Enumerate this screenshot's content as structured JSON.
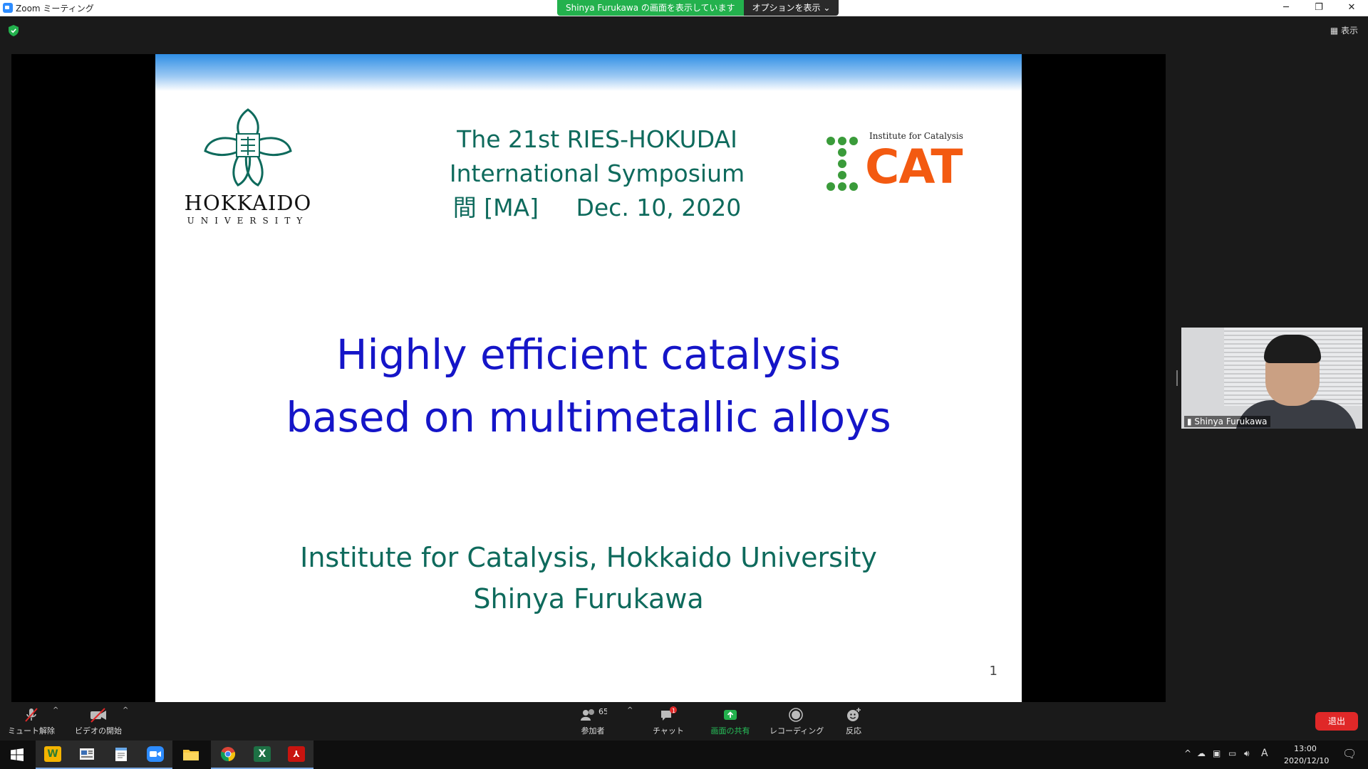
{
  "window": {
    "title": "Zoom ミーティング",
    "minimize": "─",
    "restore": "❐",
    "close": "✕"
  },
  "share_banner": {
    "message": "Shinya  Furukawa の画面を表示しています",
    "options": "オプションを表示 ⌄"
  },
  "view_button": "▦ 表示",
  "slide": {
    "hu_logo_name": "HOKKAIDO",
    "hu_logo_sub": "UNIVERSITY",
    "symposium_line1": "The 21st RIES-HOKUDAI",
    "symposium_line2": "International Symposium",
    "symposium_line3a": "間 [MA]",
    "symposium_line3b": "Dec. 10, 2020",
    "icat_label": "Institute for Catalysis",
    "icat_text": "CAT",
    "title_line1": "Highly efficient catalysis",
    "title_line2": "based on multimetallic alloys",
    "affiliation": "Institute for Catalysis, Hokkaido University",
    "author": "Shinya Furukawa",
    "page_number": "1",
    "colors": {
      "title": "#1515c8",
      "accent": "#0e6a5c",
      "icat": "#f35a11"
    }
  },
  "video_tile": {
    "name": "Shinya Furukawa"
  },
  "toolbar": {
    "mute": "ミュート解除",
    "video": "ビデオの開始",
    "participants": "参加者",
    "participants_count": "65",
    "chat": "チャット",
    "chat_badge": "1",
    "share": "画面の共有",
    "record": "レコーディング",
    "reactions": "反応",
    "leave": "退出"
  },
  "taskbar": {
    "apps": [
      "start",
      "word-like",
      "news",
      "notepad",
      "zoom",
      "file-explorer",
      "chrome",
      "excel",
      "acrobat"
    ],
    "clock_time": "13:00",
    "clock_date": "2020/12/10",
    "ime": "A",
    "notification_count": "1"
  }
}
